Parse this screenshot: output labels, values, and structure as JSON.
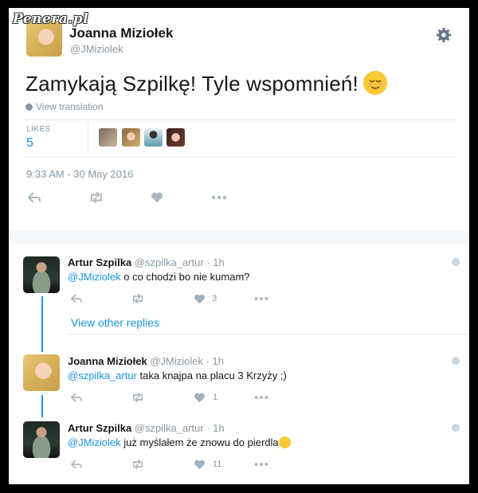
{
  "watermark": "Penera.pl",
  "colors": {
    "accent": "#1b95e0",
    "muted": "#8899a6",
    "text": "#14171a",
    "heart_icon": "#a3b1bd"
  },
  "main_tweet": {
    "author_name": "Joanna Miziołek",
    "author_handle": "@JMiziolek",
    "text": "Zamykają Szpilkę! Tyle wspomnień!",
    "emoji": "relieved-face-icon",
    "view_translation": "View translation",
    "likes_label": "LIKES",
    "likes_count": "5",
    "liker_avatars": 4,
    "timestamp": "9:33 AM - 30 May 2016",
    "actions": [
      "reply-icon",
      "retweet-icon",
      "like-icon",
      "more-icon"
    ]
  },
  "replies": [
    {
      "author_name": "Artur Szpilka",
      "meta": "@szpilka_artur · 1h",
      "mention": "@JMiziolek",
      "text": " o co chodzi bo nie kumam?",
      "likes": "3",
      "avatar": "fighter"
    },
    {
      "view_other_replies": "View other replies"
    },
    {
      "author_name": "Joanna Miziołek",
      "meta": "@JMiziolek · 1h",
      "mention": "@szpilka_artur",
      "text": " taka knajpa na placu 3 Krzyży ;)",
      "likes": "1",
      "avatar": "blonde"
    },
    {
      "author_name": "Artur Szpilka",
      "meta": "@szpilka_artur · 1h",
      "mention": "@JMiziolek",
      "text": " już myślałem że znowu do pierdla",
      "emoji": "tears-of-joy-icon",
      "likes": "11",
      "avatar": "fighter"
    }
  ]
}
